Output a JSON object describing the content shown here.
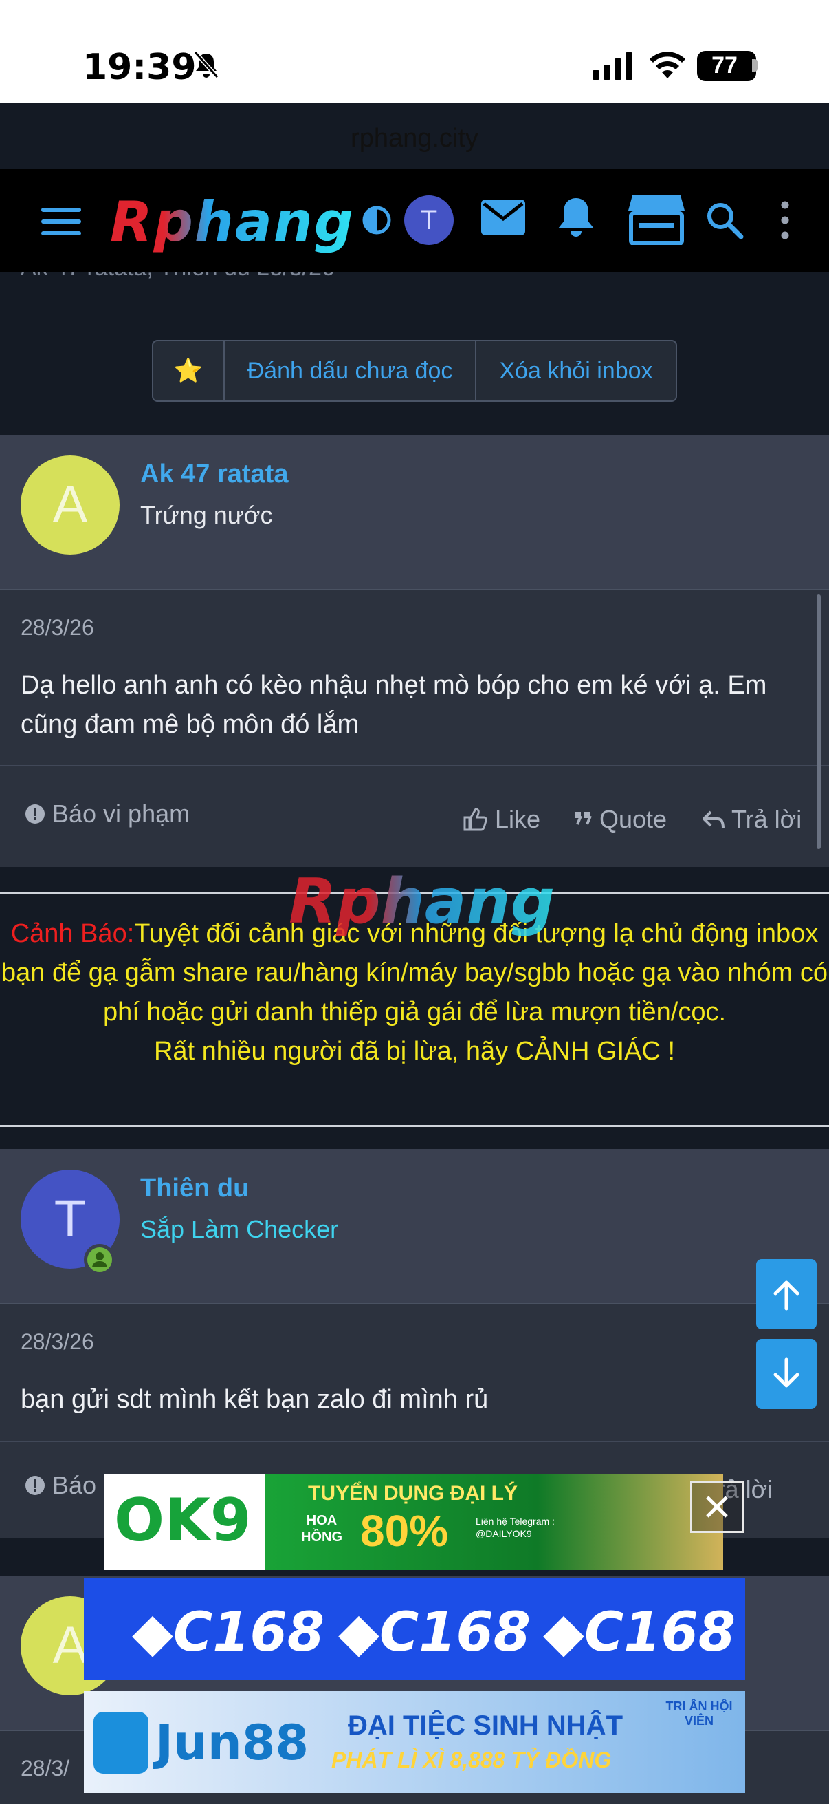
{
  "status_bar": {
    "time": "19:39",
    "battery": "77",
    "url": "rphang.city"
  },
  "nav": {
    "logo_text": "Rphang",
    "avatar_letter": "T"
  },
  "thread": {
    "meta_text": "Ak 47 ratata, Thiên du   28/3/26",
    "star_icon": "⭐",
    "mark_unread": "Đánh dấu chưa đọc",
    "remove_inbox": "Xóa khỏi inbox"
  },
  "messages": [
    {
      "avatar_letter": "A",
      "username": "Ak 47 ratata",
      "user_title": "Trứng nước",
      "date": "28/3/26",
      "body": "Dạ hello anh anh có kèo nhậu nhẹt mò bóp cho em ké với ạ. Em cũng đam mê bộ môn đó lắm",
      "report": "Báo vi phạm",
      "like": "Like",
      "quote": "Quote",
      "reply": "Trả lời"
    },
    {
      "avatar_letter": "T",
      "username": "Thiên du",
      "user_title": "Sắp Làm Checker",
      "date": "28/3/26",
      "body": "bạn gửi sdt mình kết bạn zalo đi mình rủ",
      "report": "Báo",
      "reply": "Trả lời"
    },
    {
      "avatar_letter": "A",
      "date": "28/3/"
    }
  ],
  "warning": {
    "label": "Cảnh Báo:",
    "text": "Tuyệt đối cảnh giác với những đối tượng lạ chủ động inbox bạn để gạ gẫm share rau/hàng kín/máy bay/sgbb hoặc gạ vào nhóm có phí hoặc gửi danh thiếp giả gái để lừa mượn tiền/cọc.",
    "text2": "Rất nhiều người đã bị lừa, hãy CẢNH GIÁC !",
    "watermark": "Rphang"
  },
  "ads": {
    "ok9": {
      "brand": "OK9",
      "headline": "TUYỂN DỤNG ĐẠI LÝ",
      "sub": "HOA HỒNG",
      "percent": "80%",
      "contact": "Liên hệ Telegram : @DAILYOK9"
    },
    "c168": {
      "brand": "C168"
    },
    "jun88": {
      "brand": "Jun88",
      "headline": "ĐẠI TIỆC SINH NHẬT",
      "sub": "PHÁT LÌ XÌ 8,888 TỶ ĐỒNG",
      "badge": "TRI ÂN HỘI VIÊN"
    }
  },
  "colors": {
    "accent": "#41a9ec",
    "warning_label": "#ee1f1f",
    "warning_text": "#f4e71f",
    "scroll_button": "#2b9be6"
  }
}
